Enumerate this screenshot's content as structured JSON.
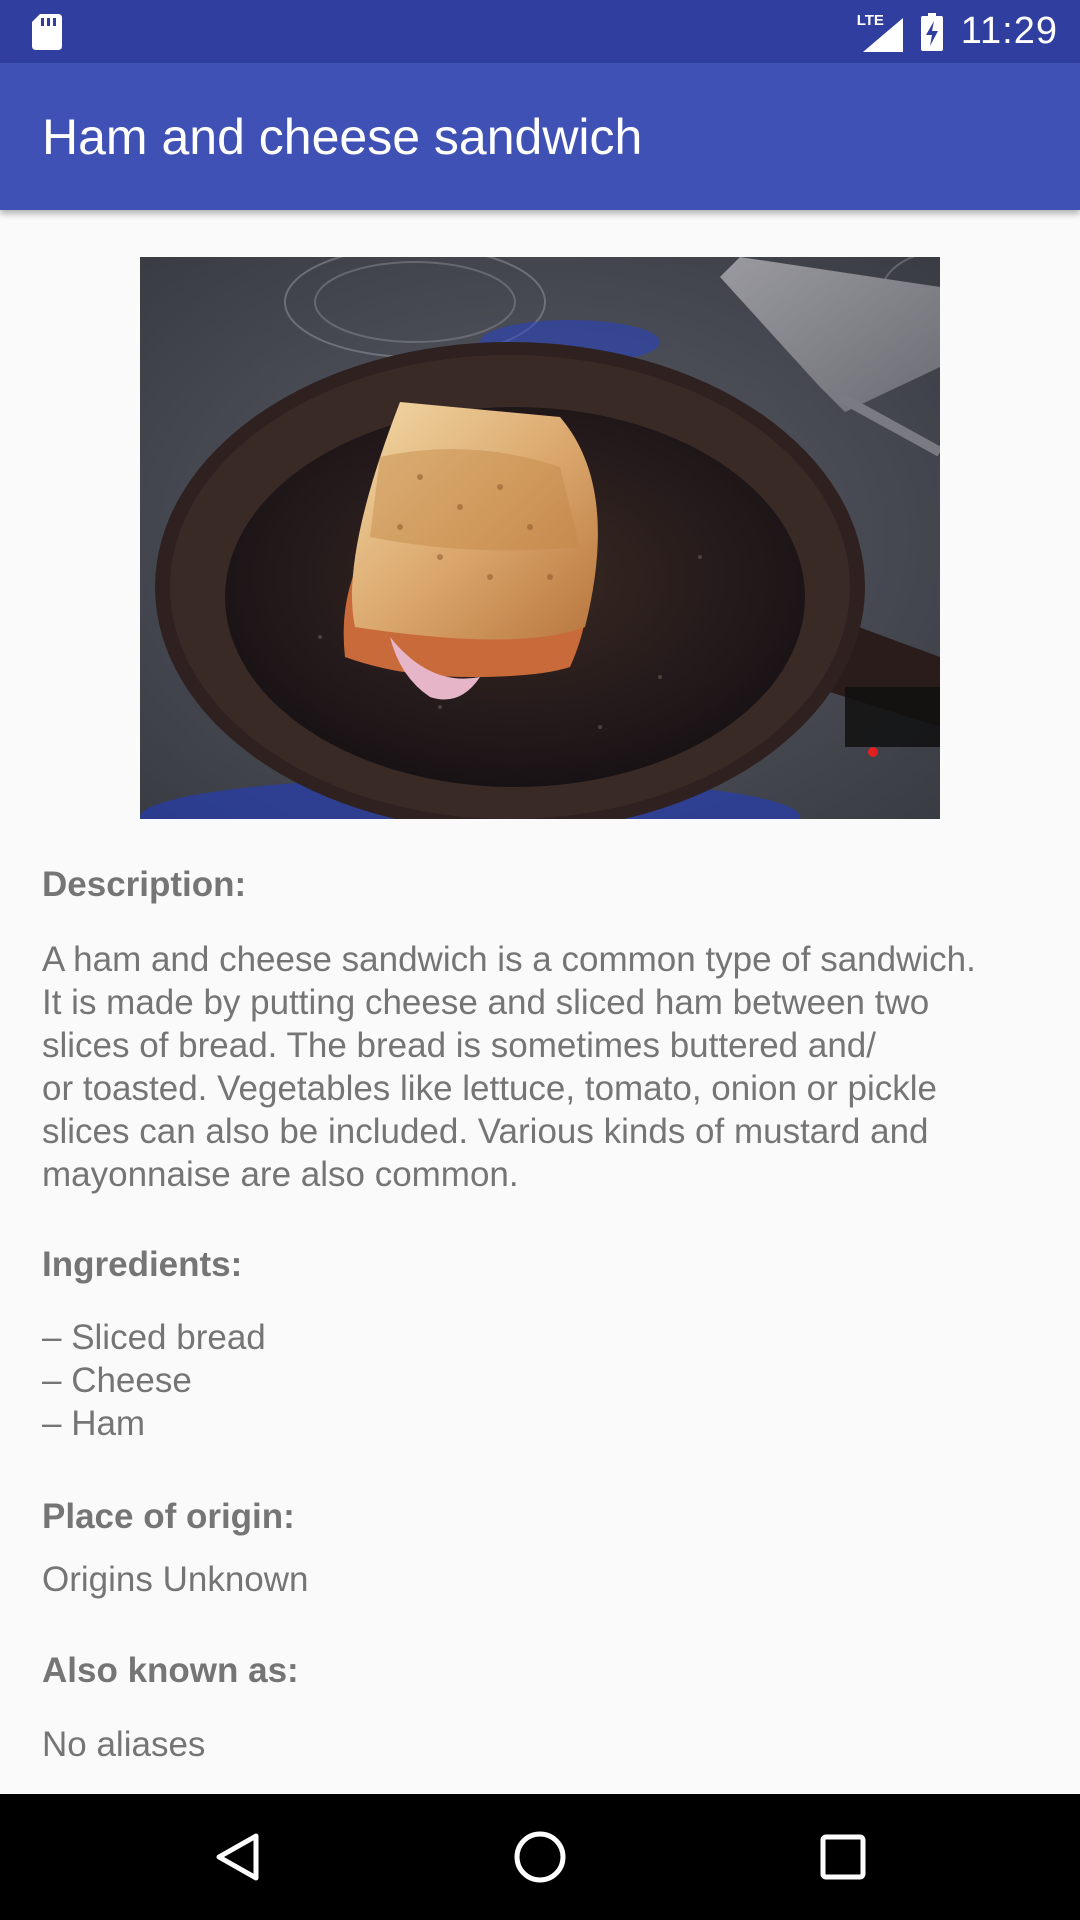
{
  "status_bar": {
    "network": "LTE",
    "time": "11:29"
  },
  "app_bar": {
    "title": "Ham and cheese sandwich"
  },
  "photo": {
    "icon": "sandwich-photo"
  },
  "description": {
    "label": "Description:",
    "lines": [
      "A ham and cheese sandwich is a common type of sandwich.",
      "It is made by putting cheese and sliced ham between two",
      "slices of bread. The bread is sometimes buttered and/",
      "or toasted. Vegetables like lettuce, tomato, onion or pickle",
      "slices can also be included. Various kinds of mustard and",
      "mayonnaise are also common."
    ]
  },
  "ingredients": {
    "label": "Ingredients:",
    "items": [
      "– Sliced bread",
      "– Cheese",
      "– Ham"
    ]
  },
  "origin": {
    "label": "Place of origin:",
    "value": "Origins Unknown"
  },
  "aliases": {
    "label": "Also known as:",
    "value": "No aliases"
  },
  "colors": {
    "status_bar": "#303f9f",
    "app_bar": "#3f51b5",
    "text": "#757575",
    "background": "#fafafa"
  }
}
